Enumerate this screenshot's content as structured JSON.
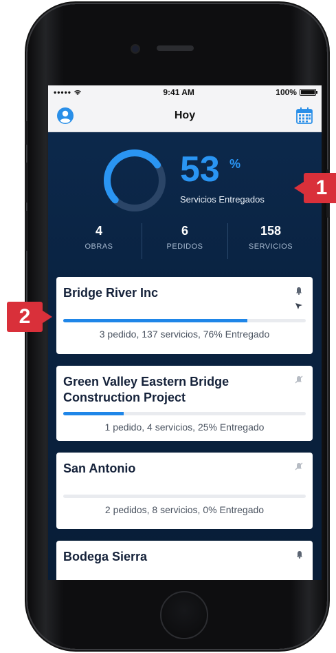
{
  "status_bar": {
    "signal": "•••••",
    "time": "9:41 AM",
    "battery": "100%"
  },
  "nav": {
    "title": "Hoy",
    "left_icon": "user-icon",
    "right_icon": "calendar-icon"
  },
  "summary": {
    "percent": "53",
    "percent_sign": "%",
    "percent_value": 0.53,
    "label": "Servicios Entregados",
    "ring_color": "#2a95f3"
  },
  "counters": [
    {
      "value": "4",
      "label": "OBRAS"
    },
    {
      "value": "6",
      "label": "PEDIDOS"
    },
    {
      "value": "158",
      "label": "SERVICIOS"
    }
  ],
  "projects": [
    {
      "title": "Bridge River Inc",
      "summary": "3 pedido, 137 servicios, 76% Entregado",
      "progress": 0.76,
      "icons": [
        "bell-icon",
        "navigation-icon"
      ]
    },
    {
      "title": "Green Valley Eastern  Bridge Construction Project",
      "summary": "1 pedido, 4 servicios, 25% Entregado",
      "progress": 0.25,
      "icons": [
        "bell-off-icon"
      ]
    },
    {
      "title": "San Antonio",
      "summary": "2 pedidos, 8 servicios, 0% Entregado",
      "progress": 0.0,
      "icons": [
        "bell-off-icon"
      ]
    },
    {
      "title": "Bodega Sierra",
      "summary": "",
      "progress": 0.0,
      "icons": [
        "bell-icon"
      ]
    }
  ],
  "annotations": [
    "1",
    "2"
  ],
  "colors": {
    "accent": "#2a95f3",
    "badge": "#d9303a",
    "background": "#0a2342"
  }
}
